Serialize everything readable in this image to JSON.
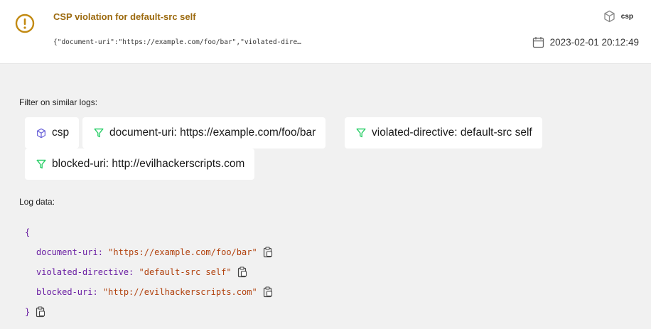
{
  "header": {
    "title": "CSP violation for default-src self",
    "preview": "{\"document-uri\":\"https://example.com/foo/bar\",\"violated-dire…",
    "source_label": "csp",
    "timestamp": "2023-02-01 20:12:49"
  },
  "filters": {
    "heading": "Filter on similar logs:",
    "chips": [
      {
        "icon": "cube-icon",
        "label": "csp"
      },
      {
        "icon": "filter-icon",
        "label": "document-uri: https://example.com/foo/bar"
      },
      {
        "icon": "filter-icon",
        "label": "violated-directive: default-src self"
      },
      {
        "icon": "filter-icon",
        "label": "blocked-uri: http://evilhackerscripts.com"
      }
    ]
  },
  "log": {
    "heading": "Log data:",
    "open_brace": "{",
    "close_brace": "}",
    "entries": [
      {
        "key": "document-uri:",
        "value": "\"https://example.com/foo/bar\""
      },
      {
        "key": "violated-directive:",
        "value": "\"default-src self\""
      },
      {
        "key": "blocked-uri:",
        "value": "\"http://evilhackerscripts.com\""
      }
    ]
  },
  "colors": {
    "title": "#9c6a0f",
    "warning_icon": "#c28a12",
    "filter_icon": "#2fcf6b",
    "cube_icon": "#6b63d9",
    "code_key": "#6a1fa3",
    "code_value": "#b1410d"
  }
}
